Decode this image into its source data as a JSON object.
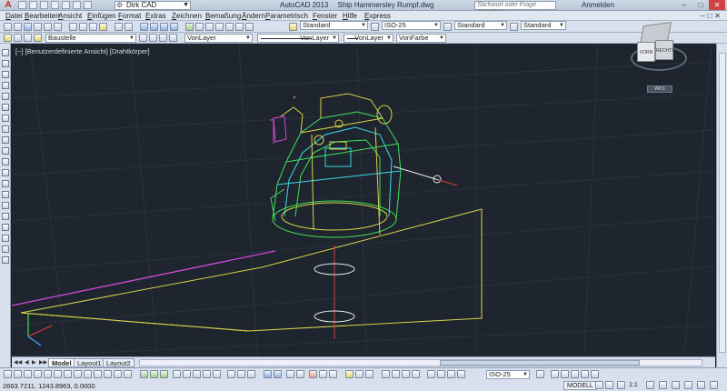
{
  "window": {
    "app_icon": "A",
    "title_app": "AutoCAD 2013",
    "title_file": "Ship Hammersley Rumpf.dwg",
    "workspace": "Dirk CAD",
    "help_search_placeholder": "Stichwort oder Frage eingeben",
    "login_label": "Anmelden"
  },
  "menu": {
    "items": [
      "Datei",
      "Bearbeiten",
      "Ansicht",
      "Einfügen",
      "Format",
      "Extras",
      "Zeichnen",
      "Bemaßung",
      "Ändern",
      "Parametrisch",
      "Fenster",
      "Hilfe",
      "Express"
    ]
  },
  "toolbar1": {
    "text_style": "Standard",
    "dim_style": "ISO-25",
    "table_style": "Standard",
    "mleader_style": "Standard"
  },
  "toolbar2": {
    "layer": "Baustelle",
    "color": "VonLayer",
    "linetype": "VonLayer",
    "lineweight": "VonLayer",
    "plotstyle": "VonFarbe"
  },
  "viewport": {
    "label_parts": [
      "[−]",
      "[Benutzerdefinierte Ansicht]",
      "[Drahtkörper]"
    ],
    "viewcube_front": "VORN",
    "viewcube_right": "RECHTS",
    "viewcube_wcs": "WKS"
  },
  "layout_tabs": [
    "Model",
    "Layout1",
    "Layout2"
  ],
  "status": {
    "coordinates": "2663.7211, 1243.8963, 0.0000",
    "annotation_scale": "ISO-25",
    "model_label": "MODELL",
    "zoom_label": "1:1"
  },
  "colors": {
    "background": "#1e252e",
    "grid": "#2b3440",
    "yellow": "#d9d24a",
    "green": "#3ee05a",
    "cyan": "#3fd8e6",
    "magenta": "#d04ad6",
    "white": "#e8e8e8",
    "red": "#d83a3a"
  }
}
